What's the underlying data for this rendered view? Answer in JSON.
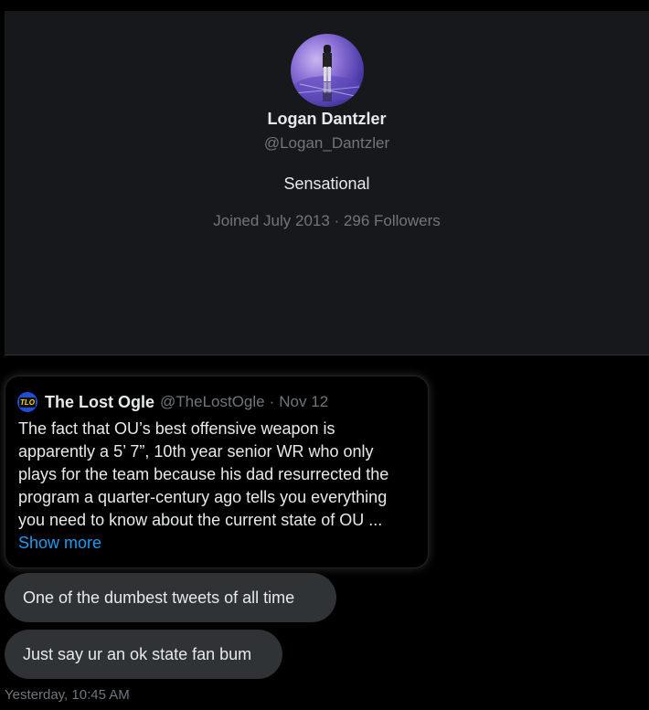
{
  "profile": {
    "name": "Logan Dantzler",
    "handle": "@Logan_Dantzler",
    "bio": "Sensational",
    "meta": "Joined July 2013 · 296 Followers",
    "avatar_icon": "avatar-photo"
  },
  "quote_tweet": {
    "icon": "tlo-logo-icon",
    "icon_text": "TLO",
    "author": "The Lost Ogle",
    "handle": "@TheLostOgle",
    "separator": "·",
    "date": "Nov 12",
    "lines": [
      "The fact that OU’s best offensive weapon is",
      "apparently a 5’ 7”, 10th year senior WR who only",
      "plays for the team because his dad resurrected the",
      "program a quarter-century ago tells you everything",
      "you need to know about the current state of OU ..."
    ],
    "show_more": "Show more"
  },
  "messages": [
    {
      "text": "One of the dumbest tweets of all time"
    },
    {
      "text": "Just say ur an ok state fan bum"
    }
  ],
  "timestamp": "Yesterday, 10:45 AM",
  "colors": {
    "background": "#000000",
    "card": "#16181c",
    "bubble": "#2f3336",
    "muted": "#71767b",
    "link": "#1d9bf0"
  }
}
